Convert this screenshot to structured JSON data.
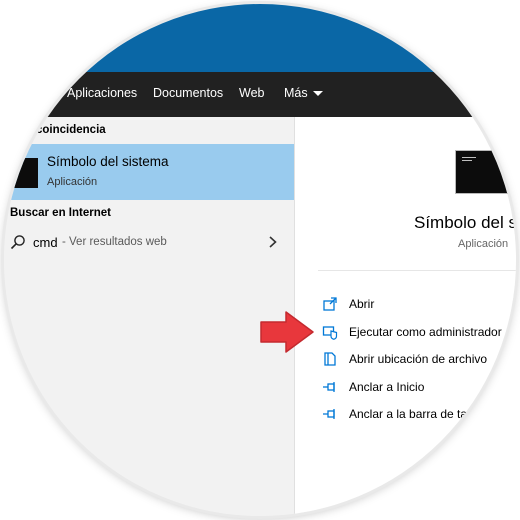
{
  "header": {
    "tabs": [
      {
        "label": "Aplicaciones"
      },
      {
        "label": "Documentos"
      },
      {
        "label": "Web"
      },
      {
        "label": "Más"
      }
    ]
  },
  "left_pane": {
    "best_match_heading": "coincidencia",
    "best_match": {
      "title": "Símbolo del sistema",
      "subtitle": "Aplicación"
    },
    "web_heading": "Buscar en Internet",
    "web_result": {
      "query": "cmd",
      "hint": "- Ver resultados web"
    }
  },
  "right_pane": {
    "app_title": "Símbolo del si",
    "app_subtitle": "Aplicación",
    "actions": [
      {
        "label": "Abrir",
        "icon": "open-icon"
      },
      {
        "label": "Ejecutar como administrador",
        "icon": "run-as-admin-icon"
      },
      {
        "label": "Abrir ubicación de archivo",
        "icon": "file-location-icon"
      },
      {
        "label": "Anclar a Inicio",
        "icon": "pin-icon"
      },
      {
        "label": "Anclar a la barra de ta",
        "icon": "pin-icon"
      }
    ]
  },
  "colors": {
    "accent_blue": "#0a67a6",
    "tab_bar": "#212121",
    "selection": "#99cbee",
    "action_icon": "#0078d7",
    "arrow_red": "#e8373c"
  }
}
